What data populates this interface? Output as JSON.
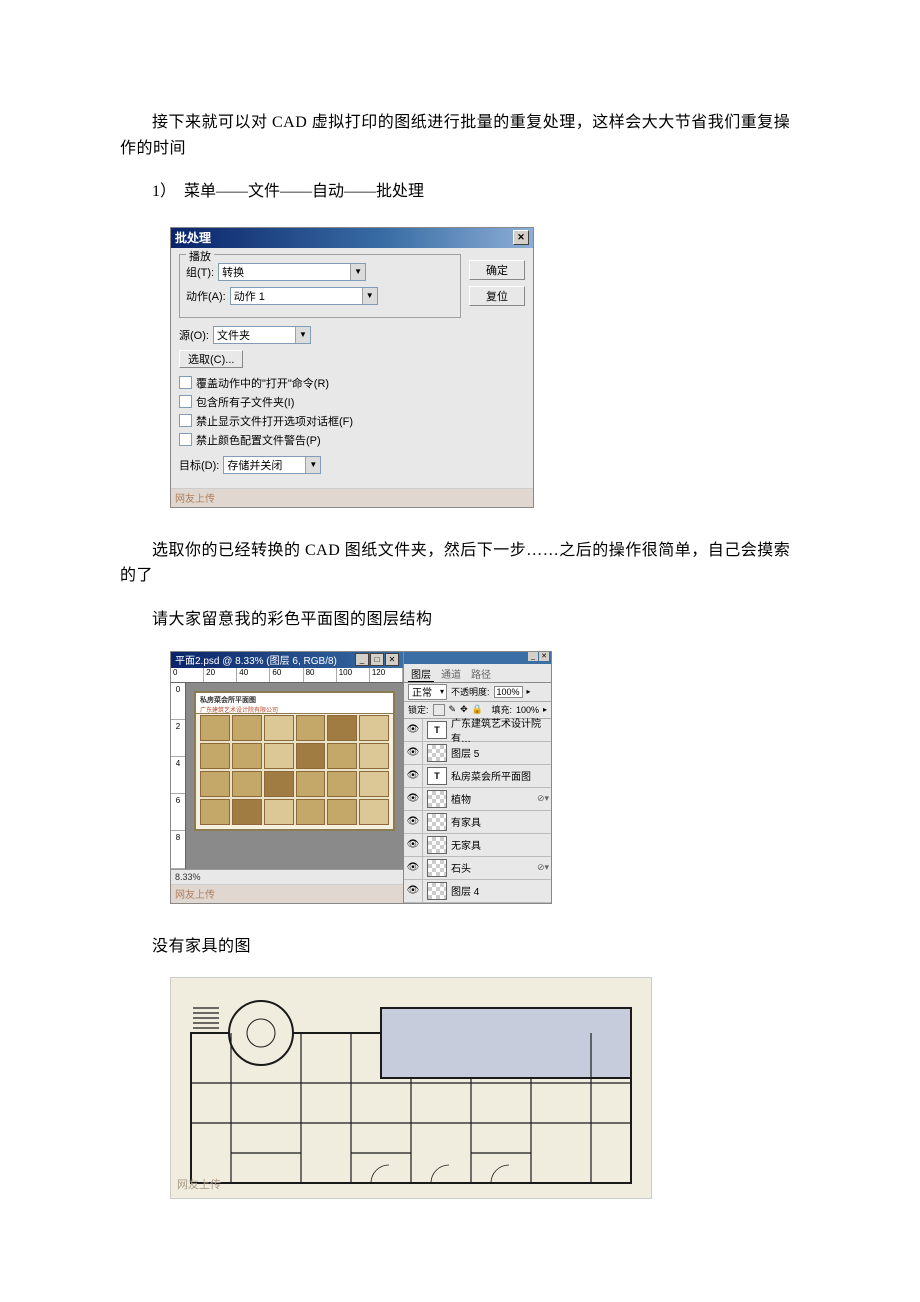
{
  "paragraphs": {
    "p1": "接下来就可以对 CAD 虚拟打印的图纸进行批量的重复处理，这样会大大节省我们重复操作的时间",
    "list1": "1）　菜单——文件——自动——批处理",
    "p2": "选取你的已经转换的 CAD 图纸文件夹，然后下一步……之后的操作很简单，自己会摸索的了",
    "p3": "请大家留意我的彩色平面图的图层结构",
    "p4": "没有家具的图"
  },
  "batch_dialog": {
    "title": "批处理",
    "close_x": "✕",
    "btn_ok": "确定",
    "btn_reset": "复位",
    "play_legend": "播放",
    "group_label": "组(T):",
    "group_value": "转换",
    "action_label": "动作(A):",
    "action_value": "动作 1",
    "source_label": "源(O):",
    "source_value": "文件夹",
    "choose_btn": "选取(C)...",
    "chk1": "覆盖动作中的\"打开\"命令(R)",
    "chk2": "包含所有子文件夹(I)",
    "chk3": "禁止显示文件打开选项对话框(F)",
    "chk4": "禁止颜色配置文件警告(P)",
    "target_label": "目标(D):",
    "target_value": "存储并关闭",
    "watermark": "网友上传"
  },
  "ps": {
    "doc_title": "平面2.psd @ 8.33% (图层 6, RGB/8)",
    "ruler_h": [
      "0",
      "20",
      "40",
      "60",
      "80",
      "100",
      "120"
    ],
    "ruler_v": [
      "0",
      "2",
      "4",
      "6",
      "8"
    ],
    "art_title1": "私房菜会所平面图",
    "art_title2": "广东建筑艺术设计院有限公司",
    "zoom": "8.33%",
    "watermark": "网友上传",
    "tabs": {
      "layers": "图层",
      "channels": "通道",
      "paths": "路径"
    },
    "blend_mode": "正常",
    "opacity_label": "不透明度:",
    "opacity_value": "100%",
    "lock_label": "锁定:",
    "fill_label": "填充:",
    "fill_value": "100%",
    "layers": [
      {
        "name": "广东建筑艺术设计院有…",
        "type": "text"
      },
      {
        "name": "图层 5",
        "type": "raster"
      },
      {
        "name": "私房菜会所平面图",
        "type": "text"
      },
      {
        "name": "植物",
        "type": "raster",
        "fx": true
      },
      {
        "name": "有家具",
        "type": "raster"
      },
      {
        "name": "无家具",
        "type": "raster"
      },
      {
        "name": "石头",
        "type": "raster",
        "fx": true
      },
      {
        "name": "图层 4",
        "type": "raster"
      }
    ]
  },
  "floorplan": {
    "watermark": "网友上传"
  }
}
